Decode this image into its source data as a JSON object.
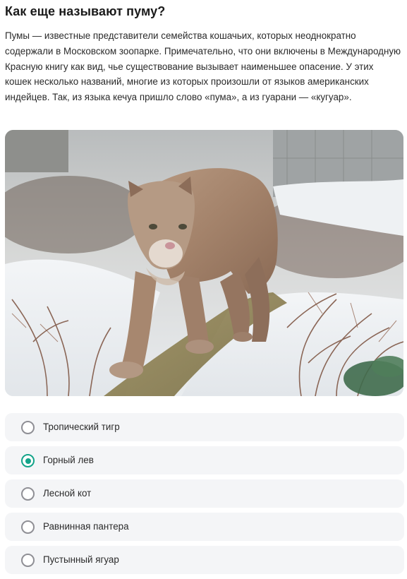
{
  "question": {
    "title": "Как еще называют пуму?",
    "description": "Пумы — известные представители семейства кошачьих, которых неоднократно содержали в Московском зоопарке. Примечательно, что они включены в Международную Красную книгу как вид, чье существование вызывает наименьшее опасение. У этих кошек несколько названий, многие из которых произошли от языков американских индейцев. Так, из языка кечуа пришло слово «пума», а из гуарани — «кугуар»."
  },
  "photo": {
    "subject": "cougar-walking-in-snow"
  },
  "options": [
    {
      "label": "Тропический тигр",
      "selected": false
    },
    {
      "label": "Горный лев",
      "selected": true
    },
    {
      "label": "Лесной кот",
      "selected": false
    },
    {
      "label": "Равнинная пантера",
      "selected": false
    },
    {
      "label": "Пустынный ягуар",
      "selected": false
    }
  ],
  "colors": {
    "accent": "#13a389",
    "option_bg": "#f4f5f7",
    "radio_border": "#8f8f95"
  }
}
